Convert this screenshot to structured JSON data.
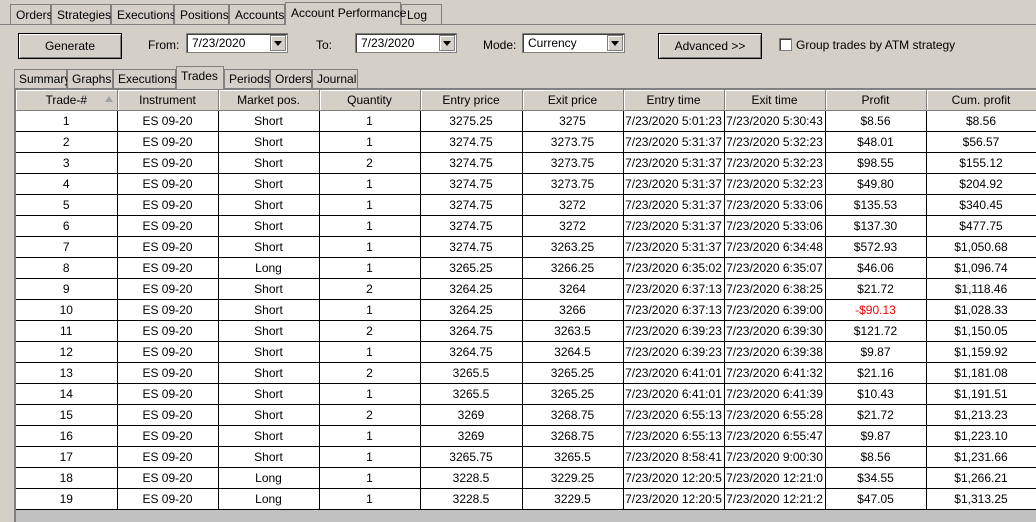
{
  "top_tabs": [
    {
      "label": "Orders",
      "active": false
    },
    {
      "label": "Strategies",
      "active": false
    },
    {
      "label": "Executions",
      "active": false
    },
    {
      "label": "Positions",
      "active": false
    },
    {
      "label": "Accounts",
      "active": false
    },
    {
      "label": "Account Performance",
      "active": true
    },
    {
      "label": "Log",
      "active": false
    }
  ],
  "toolbar": {
    "generate_label": "Generate",
    "from_label": "From:",
    "from_value": "7/23/2020",
    "to_label": "To:",
    "to_value": "7/23/2020",
    "mode_label": "Mode:",
    "mode_value": "Currency",
    "advanced_label": "Advanced >>",
    "group_label": "Group trades by ATM strategy",
    "group_checked": false
  },
  "sub_tabs": [
    {
      "label": "Summary",
      "active": false
    },
    {
      "label": "Graphs",
      "active": false
    },
    {
      "label": "Executions",
      "active": false
    },
    {
      "label": "Trades",
      "active": true
    },
    {
      "label": "Periods",
      "active": false
    },
    {
      "label": "Orders",
      "active": false
    },
    {
      "label": "Journal",
      "active": false
    }
  ],
  "table": {
    "columns": [
      "Trade-#",
      "Instrument",
      "Market pos.",
      "Quantity",
      "Entry price",
      "Exit price",
      "Entry time",
      "Exit time",
      "Profit",
      "Cum. profit"
    ],
    "rows": [
      [
        "1",
        "ES 09-20",
        "Short",
        "1",
        "3275.25",
        "3275",
        "7/23/2020 5:01:23",
        "7/23/2020 5:30:43",
        "$8.56",
        "$8.56"
      ],
      [
        "2",
        "ES 09-20",
        "Short",
        "1",
        "3274.75",
        "3273.75",
        "7/23/2020 5:31:37",
        "7/23/2020 5:32:23",
        "$48.01",
        "$56.57"
      ],
      [
        "3",
        "ES 09-20",
        "Short",
        "2",
        "3274.75",
        "3273.75",
        "7/23/2020 5:31:37",
        "7/23/2020 5:32:23",
        "$98.55",
        "$155.12"
      ],
      [
        "4",
        "ES 09-20",
        "Short",
        "1",
        "3274.75",
        "3273.75",
        "7/23/2020 5:31:37",
        "7/23/2020 5:32:23",
        "$49.80",
        "$204.92"
      ],
      [
        "5",
        "ES 09-20",
        "Short",
        "1",
        "3274.75",
        "3272",
        "7/23/2020 5:31:37",
        "7/23/2020 5:33:06",
        "$135.53",
        "$340.45"
      ],
      [
        "6",
        "ES 09-20",
        "Short",
        "1",
        "3274.75",
        "3272",
        "7/23/2020 5:31:37",
        "7/23/2020 5:33:06",
        "$137.30",
        "$477.75"
      ],
      [
        "7",
        "ES 09-20",
        "Short",
        "1",
        "3274.75",
        "3263.25",
        "7/23/2020 5:31:37",
        "7/23/2020 6:34:48",
        "$572.93",
        "$1,050.68"
      ],
      [
        "8",
        "ES 09-20",
        "Long",
        "1",
        "3265.25",
        "3266.25",
        "7/23/2020 6:35:02",
        "7/23/2020 6:35:07",
        "$46.06",
        "$1,096.74"
      ],
      [
        "9",
        "ES 09-20",
        "Short",
        "2",
        "3264.25",
        "3264",
        "7/23/2020 6:37:13",
        "7/23/2020 6:38:25",
        "$21.72",
        "$1,118.46"
      ],
      [
        "10",
        "ES 09-20",
        "Short",
        "1",
        "3264.25",
        "3266",
        "7/23/2020 6:37:13",
        "7/23/2020 6:39:00",
        "-$90.13",
        "$1,028.33"
      ],
      [
        "11",
        "ES 09-20",
        "Short",
        "2",
        "3264.75",
        "3263.5",
        "7/23/2020 6:39:23",
        "7/23/2020 6:39:30",
        "$121.72",
        "$1,150.05"
      ],
      [
        "12",
        "ES 09-20",
        "Short",
        "1",
        "3264.75",
        "3264.5",
        "7/23/2020 6:39:23",
        "7/23/2020 6:39:38",
        "$9.87",
        "$1,159.92"
      ],
      [
        "13",
        "ES 09-20",
        "Short",
        "2",
        "3265.5",
        "3265.25",
        "7/23/2020 6:41:01",
        "7/23/2020 6:41:32",
        "$21.16",
        "$1,181.08"
      ],
      [
        "14",
        "ES 09-20",
        "Short",
        "1",
        "3265.5",
        "3265.25",
        "7/23/2020 6:41:01",
        "7/23/2020 6:41:39",
        "$10.43",
        "$1,191.51"
      ],
      [
        "15",
        "ES 09-20",
        "Short",
        "2",
        "3269",
        "3268.75",
        "7/23/2020 6:55:13",
        "7/23/2020 6:55:28",
        "$21.72",
        "$1,213.23"
      ],
      [
        "16",
        "ES 09-20",
        "Short",
        "1",
        "3269",
        "3268.75",
        "7/23/2020 6:55:13",
        "7/23/2020 6:55:47",
        "$9.87",
        "$1,223.10"
      ],
      [
        "17",
        "ES 09-20",
        "Short",
        "1",
        "3265.75",
        "3265.5",
        "7/23/2020 8:58:41",
        "7/23/2020 9:00:30",
        "$8.56",
        "$1,231.66"
      ],
      [
        "18",
        "ES 09-20",
        "Long",
        "1",
        "3228.5",
        "3229.25",
        "7/23/2020 12:20:5",
        "7/23/2020 12:21:0",
        "$34.55",
        "$1,266.21"
      ],
      [
        "19",
        "ES 09-20",
        "Long",
        "1",
        "3228.5",
        "3229.5",
        "7/23/2020 12:20:5",
        "7/23/2020 12:21:2",
        "$47.05",
        "$1,313.25"
      ]
    ],
    "negative_color": "#ff0000"
  }
}
